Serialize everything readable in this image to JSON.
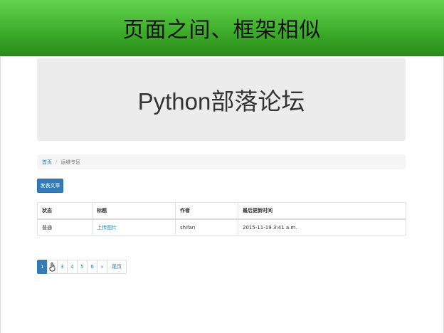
{
  "slide": {
    "title": "页面之间、框架相似"
  },
  "site": {
    "title": "Python部落论坛"
  },
  "breadcrumb": {
    "home": "首页",
    "current": "运维专区"
  },
  "actions": {
    "post_label": "发表文章"
  },
  "table": {
    "headers": [
      "状态",
      "标题",
      "作者",
      "最后更新时间"
    ],
    "rows": [
      {
        "status": "普通",
        "title": "上传图片",
        "author": "shifan",
        "updated": "2015-11-19 3:41 a.m."
      }
    ]
  },
  "pagination": {
    "pages": [
      "1",
      "2",
      "3",
      "4",
      "5",
      "6"
    ],
    "next": "»",
    "last": "尾页",
    "active": "1"
  },
  "colors": {
    "header_green": "#3fae2c",
    "primary": "#337ab7"
  }
}
